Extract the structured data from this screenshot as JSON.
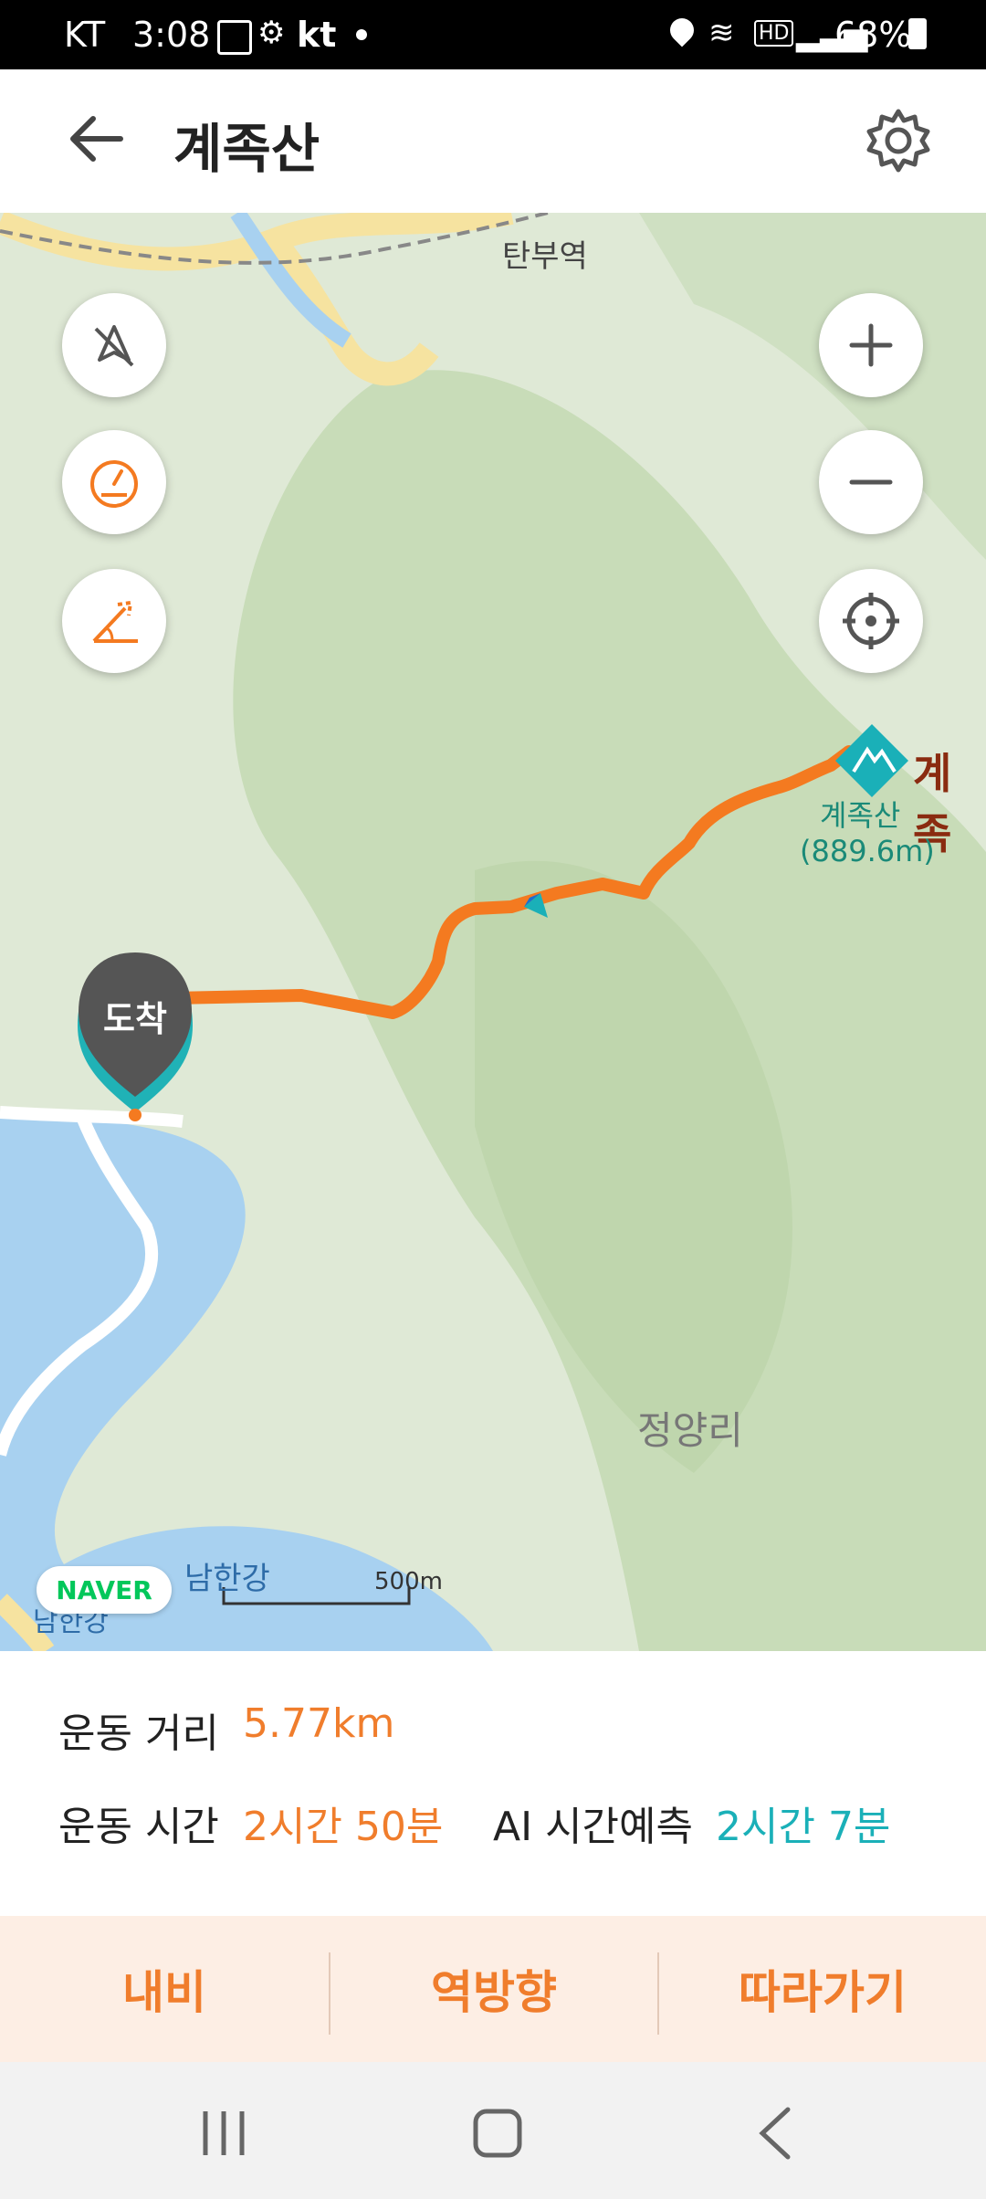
{
  "status_bar": {
    "carrier": "KT",
    "time": "3:08",
    "carrier2": "kt",
    "battery": "68%"
  },
  "header": {
    "title": "계족산",
    "back_icon": "arrow-left-icon",
    "settings_icon": "gear-icon"
  },
  "map": {
    "labels": {
      "station": "탄부역",
      "peak_name": "계족산",
      "peak_elevation": "(889.6m)",
      "peak_label_cut": "계족",
      "village": "정양리",
      "river": "남한강",
      "river2": "남한강",
      "scale": "500m",
      "arrival": "도착",
      "naver": "NAVER"
    },
    "controls": {
      "left": [
        "compass-off-icon",
        "speedometer-icon",
        "slope-icon"
      ],
      "right": [
        "zoom-in-icon",
        "zoom-out-icon",
        "locate-icon"
      ]
    },
    "colors": {
      "route": "#f47a20",
      "water": "#a8d1f0",
      "land": "#d9e7cf",
      "road": "#f6e3a0"
    }
  },
  "stats": {
    "distance_label": "운동 거리",
    "distance_value": "5.77km",
    "time_label": "운동 시간",
    "time_value": "2시간 50분",
    "ai_label": "AI 시간예측",
    "ai_value": "2시간 7분"
  },
  "actions": {
    "nav": "내비",
    "reverse": "역방향",
    "follow": "따라가기"
  },
  "colors": {
    "accent_orange": "#f07d2c",
    "accent_teal": "#1ab0b8",
    "action_bg": "#fdeee4"
  }
}
